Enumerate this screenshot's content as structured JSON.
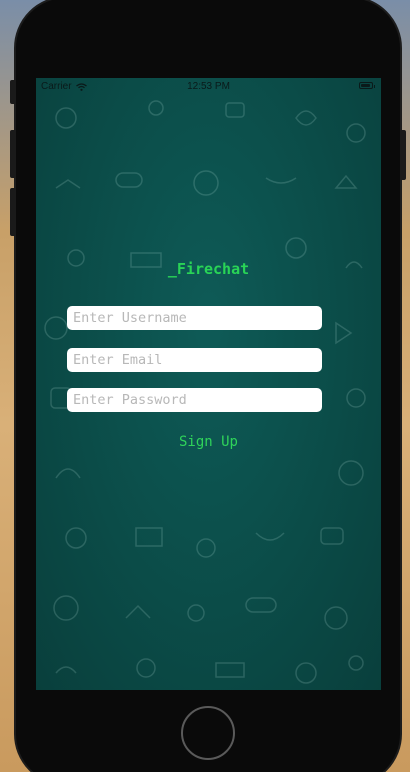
{
  "status_bar": {
    "carrier": "Carrier",
    "time": "12:53 PM"
  },
  "app": {
    "title": "_Firechat"
  },
  "form": {
    "username_placeholder": "Enter Username",
    "email_placeholder": "Enter Email",
    "password_placeholder": "Enter Password",
    "signup_label": "Sign Up"
  },
  "colors": {
    "background": "#0b4c48",
    "accent_green": "#29d456",
    "field_bg": "#ffffff"
  },
  "icons": [
    "wifi-icon",
    "battery-icon",
    "home-button"
  ]
}
